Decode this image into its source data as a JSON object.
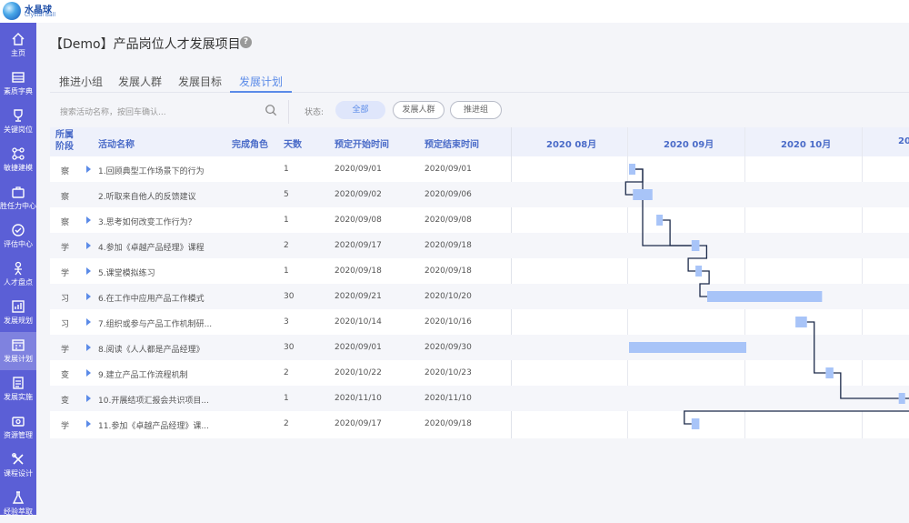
{
  "brand": {
    "name_cn": "水晶球",
    "name_en": "Crystal Ball"
  },
  "nav": [
    {
      "label": "主页",
      "icon": "home-icon",
      "active": false
    },
    {
      "label": "素质字典",
      "icon": "dictionary-icon",
      "active": false
    },
    {
      "label": "关键岗位",
      "icon": "trophy-icon",
      "active": false
    },
    {
      "label": "敏捷建模",
      "icon": "modeling-icon",
      "active": false
    },
    {
      "label": "胜任力中心",
      "icon": "briefcase-icon",
      "active": false
    },
    {
      "label": "评估中心",
      "icon": "assessment-icon",
      "active": false
    },
    {
      "label": "人才盘点",
      "icon": "person-icon",
      "active": false
    },
    {
      "label": "发展规划",
      "icon": "plan-icon",
      "active": false
    },
    {
      "label": "发展计划",
      "icon": "calendar-icon",
      "active": true
    },
    {
      "label": "发展实施",
      "icon": "implement-icon",
      "active": false
    },
    {
      "label": "资源管理",
      "icon": "resource-icon",
      "active": false
    },
    {
      "label": "课程设计",
      "icon": "course-icon",
      "active": false
    },
    {
      "label": "经验萃取",
      "icon": "flask-icon",
      "active": false
    }
  ],
  "page": {
    "title": "【Demo】产品岗位人才发展项目",
    "help": "?"
  },
  "tabs": [
    {
      "label": "推进小组",
      "active": false
    },
    {
      "label": "发展人群",
      "active": false
    },
    {
      "label": "发展目标",
      "active": false
    },
    {
      "label": "发展计划",
      "active": true
    }
  ],
  "filter": {
    "search_placeholder": "搜索活动名称，按回车确认...",
    "status_label": "状态:",
    "pills": [
      "全部",
      "发展人群",
      "推进组"
    ]
  },
  "table": {
    "headers": {
      "stage": "所属\n阶段",
      "name": "活动名称",
      "role": "完成角色",
      "days": "天数",
      "start": "预定开始时间",
      "end": "预定结束时间"
    },
    "months": [
      "2020 08月",
      "2020 09月",
      "2020 10月",
      "20"
    ],
    "rows": [
      {
        "stage": "察",
        "name": "1.回顾典型工作场景下的行为",
        "expandable": true,
        "role": "",
        "days": "1",
        "start": "2020/09/01",
        "end": "2020/09/01"
      },
      {
        "stage": "察",
        "name": "2.听取来自他人的反馈建议",
        "expandable": false,
        "role": "",
        "days": "5",
        "start": "2020/09/02",
        "end": "2020/09/06"
      },
      {
        "stage": "察",
        "name": "3.思考如何改变工作行为？",
        "expandable": true,
        "role": "",
        "days": "1",
        "start": "2020/09/08",
        "end": "2020/09/08"
      },
      {
        "stage": "学",
        "name": "4.参加《卓越产品经理》课程",
        "expandable": true,
        "role": "",
        "days": "2",
        "start": "2020/09/17",
        "end": "2020/09/18"
      },
      {
        "stage": "学",
        "name": "5.课堂模拟练习",
        "expandable": true,
        "role": "",
        "days": "1",
        "start": "2020/09/18",
        "end": "2020/09/18"
      },
      {
        "stage": "习",
        "name": "6.在工作中应用产品工作模式",
        "expandable": true,
        "role": "",
        "days": "30",
        "start": "2020/09/21",
        "end": "2020/10/20"
      },
      {
        "stage": "习",
        "name": "7.组织或参与产品工作机制研...",
        "expandable": true,
        "role": "",
        "days": "3",
        "start": "2020/10/14",
        "end": "2020/10/16"
      },
      {
        "stage": "学",
        "name": "8.阅读《人人都是产品经理》",
        "expandable": true,
        "role": "",
        "days": "30",
        "start": "2020/09/01",
        "end": "2020/09/30"
      },
      {
        "stage": "变",
        "name": "9.建立产品工作流程机制",
        "expandable": true,
        "role": "",
        "days": "2",
        "start": "2020/10/22",
        "end": "2020/10/23"
      },
      {
        "stage": "变",
        "name": "10.开展结项汇报会共识项目...",
        "expandable": true,
        "role": "",
        "days": "1",
        "start": "2020/11/10",
        "end": "2020/11/10"
      },
      {
        "stage": "学",
        "name": "11.参加《卓越产品经理》课...",
        "expandable": true,
        "role": "",
        "days": "2",
        "start": "2020/09/17",
        "end": "2020/09/18"
      }
    ]
  },
  "colors": {
    "nav_bg": "#5b5fd6",
    "accent": "#5b8be8",
    "bar": "#a8c4f8",
    "link": "#1c2a4a"
  }
}
